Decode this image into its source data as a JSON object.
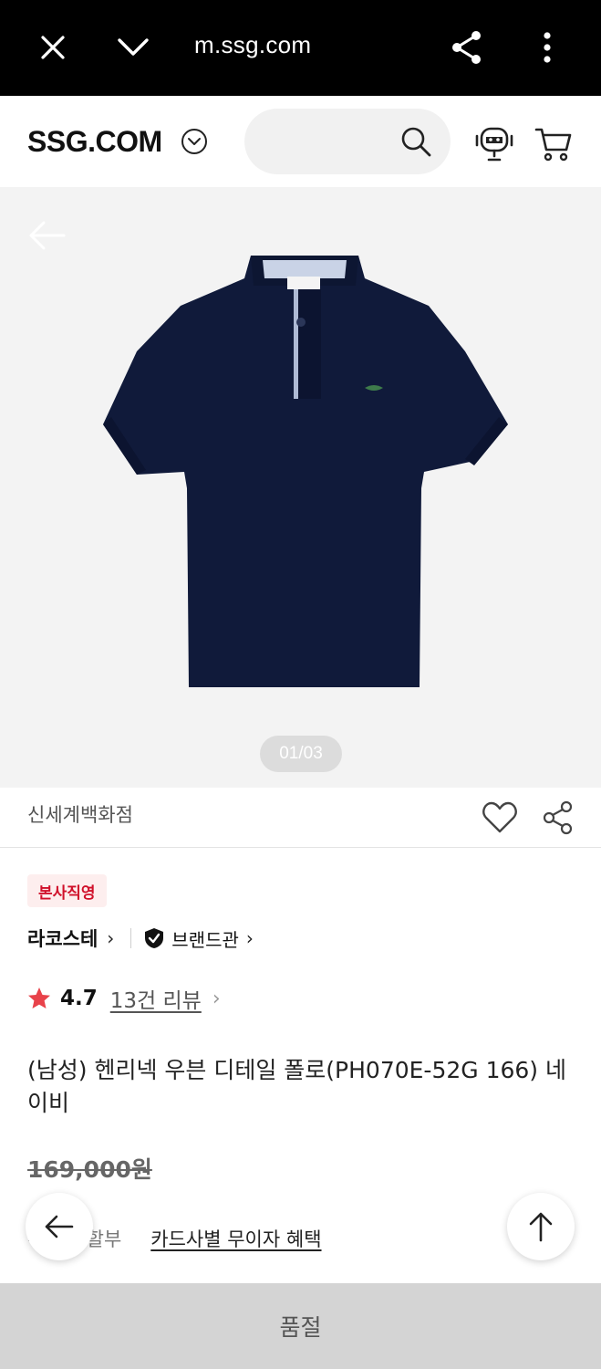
{
  "browser": {
    "url": "m.ssg.com",
    "icons": [
      "close-icon",
      "chevron-down-icon",
      "share-icon",
      "more-vertical-icon"
    ]
  },
  "header": {
    "logo": "SSG.COM",
    "search_placeholder": "",
    "icons": [
      "chevron-down-circle-icon",
      "search-icon",
      "chatbot-icon",
      "cart-icon"
    ]
  },
  "gallery": {
    "page_indicator": "01/03",
    "current_image": 1,
    "total_images": 3
  },
  "store": {
    "name": "신세계백화점"
  },
  "product": {
    "badge": "본사직영",
    "brand": "라코스테",
    "brand_hall": "브랜드관",
    "rating": "4.7",
    "review_link": "13건 리뷰",
    "title": "(남성) 헨리넥 우븐 디테일 폴로(PH070E-52G 166) 네이비",
    "original_price": "169,000원",
    "installment_label": "무이자 할부",
    "installment_link": "카드사별 무이자 혜택"
  },
  "bottom_bar": {
    "label": "품절"
  },
  "colors": {
    "browser_bar": "#000000",
    "badge_text": "#d0112b",
    "badge_bg": "#fdeeee",
    "star": "#e8424a",
    "soldout_bg": "#d4d4d4",
    "shirt": "#101a3a"
  }
}
